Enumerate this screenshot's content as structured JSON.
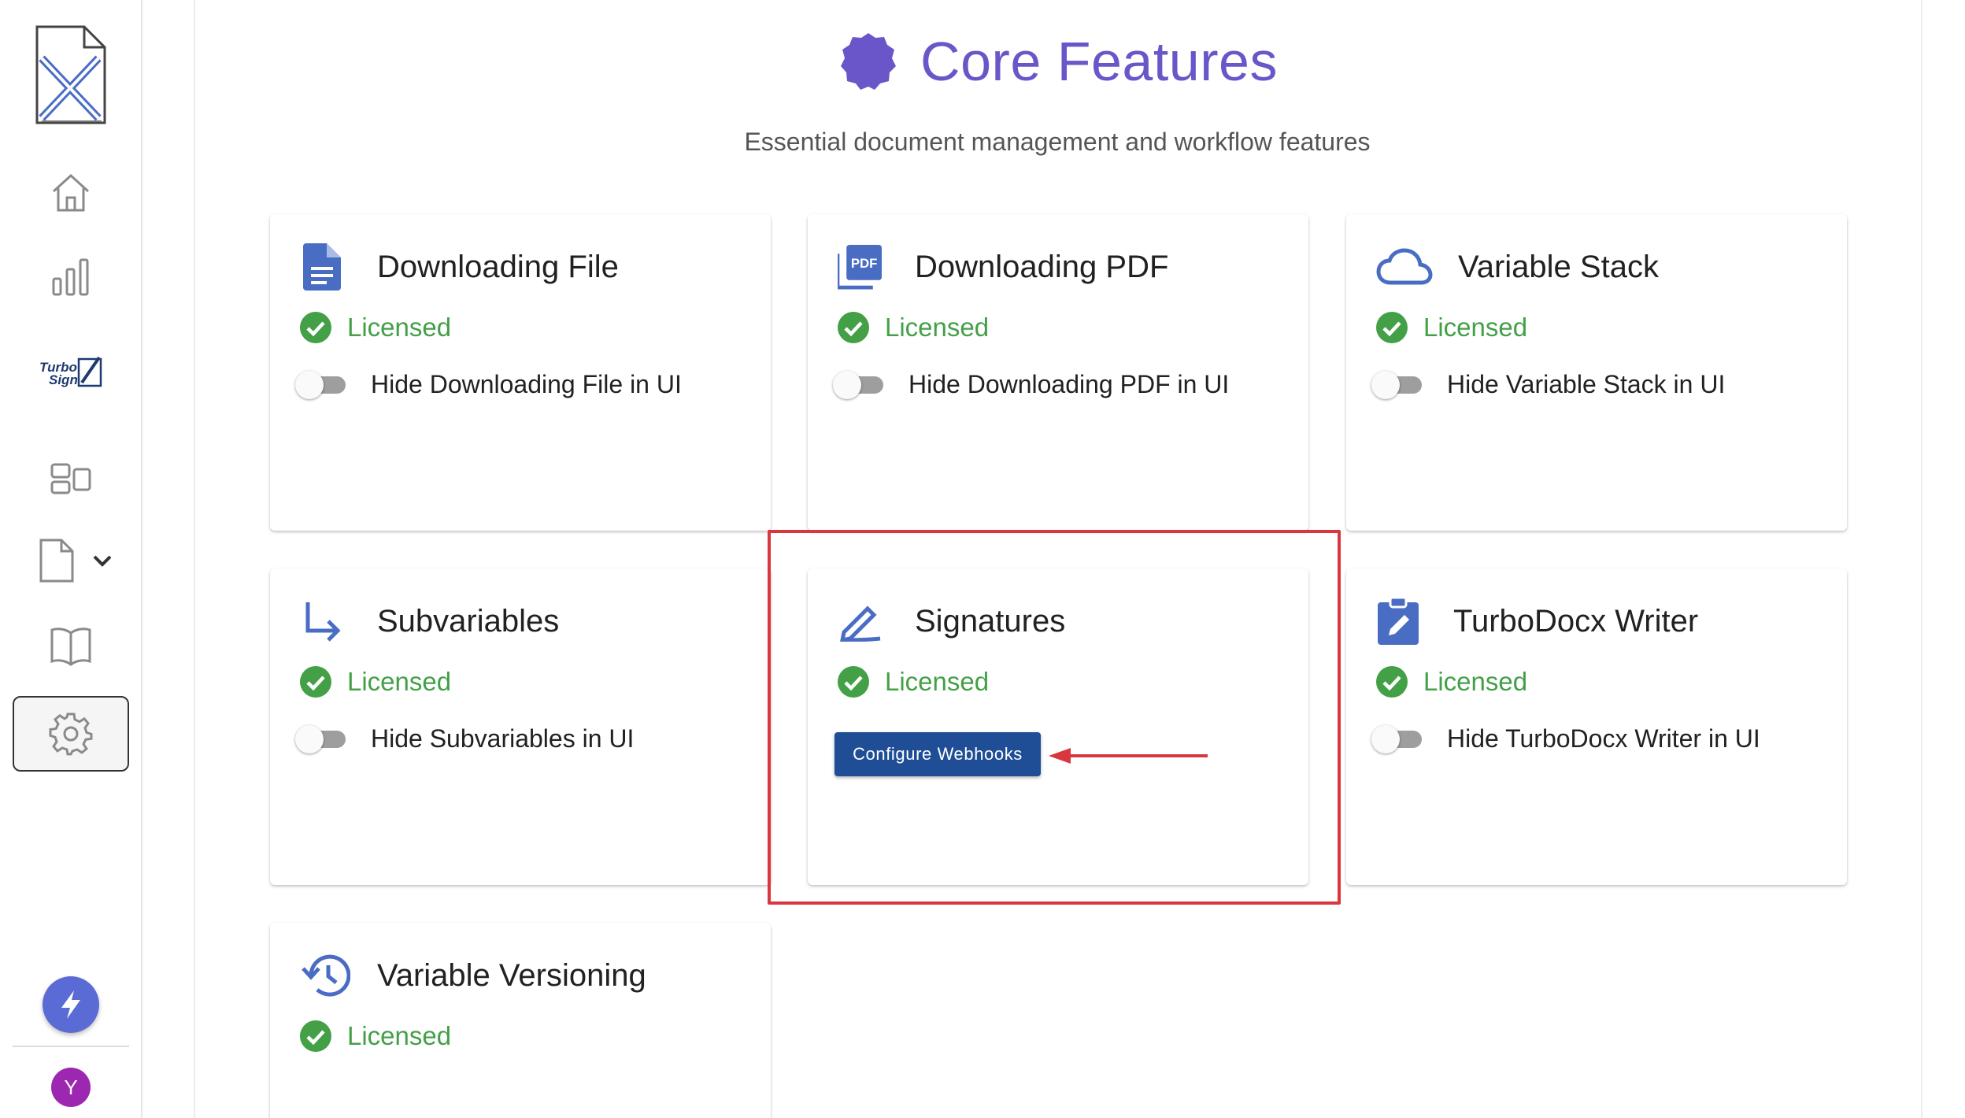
{
  "sidebar": {
    "turbosign_line1": "Turbo",
    "turbosign_line2": "Sign",
    "avatar_initial": "Y"
  },
  "header": {
    "title": "Core Features",
    "subtitle": "Essential document management and workflow features"
  },
  "colors": {
    "title": "#6a56c9",
    "icon_blue": "#4a6dc4",
    "licensed_green": "#43a047",
    "button_blue": "#1f4e96",
    "highlight_red": "#d9363e"
  },
  "cards": [
    {
      "title": "Downloading File",
      "icon": "file-document-icon",
      "status": "Licensed",
      "toggle_label": "Hide Downloading File in UI"
    },
    {
      "title": "Downloading PDF",
      "icon": "pdf-icon",
      "status": "Licensed",
      "toggle_label": "Hide Downloading PDF in UI"
    },
    {
      "title": "Variable Stack",
      "icon": "cloud-icon",
      "status": "Licensed",
      "toggle_label": "Hide Variable Stack in UI"
    },
    {
      "title": "Subvariables",
      "icon": "subdirectory-arrow-icon",
      "status": "Licensed",
      "toggle_label": "Hide Subvariables in UI"
    },
    {
      "title": "Signatures",
      "icon": "signature-pen-icon",
      "status": "Licensed",
      "button_label": "Configure Webhooks"
    },
    {
      "title": "TurboDocx Writer",
      "icon": "clipboard-edit-icon",
      "status": "Licensed",
      "toggle_label": "Hide TurboDocx Writer in UI"
    },
    {
      "title": "Variable Versioning",
      "icon": "history-icon",
      "status": "Licensed"
    }
  ]
}
